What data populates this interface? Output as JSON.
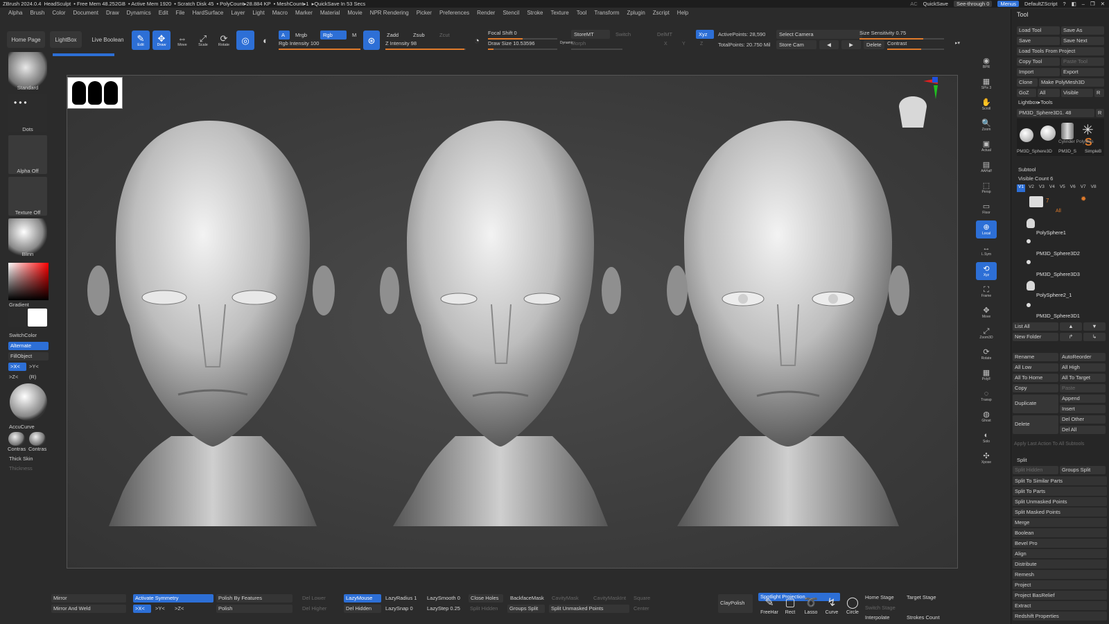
{
  "titlebar": {
    "app": "ZBrush 2024.0.4",
    "doc": "HeadSculpt",
    "free_mem": "• Free Mem 48.252GB",
    "active_mem": "• Active Mem 1920",
    "scratch": "• Scratch Disk 45",
    "polycount": "• PolyCount▸28.884 KP",
    "meshcount": "• MeshCount▸1",
    "quicksave": "▸QuickSave In 53 Secs",
    "ac": "AC",
    "quicksave_btn": "QuickSave",
    "seethrough": "See-through  0",
    "menus": "Menus",
    "defaultzscript": "DefaultZScript"
  },
  "menu": [
    "Alpha",
    "Brush",
    "Color",
    "Document",
    "Draw",
    "Dynamics",
    "Edit",
    "File",
    "HardSurface",
    "Layer",
    "Light",
    "Macro",
    "Marker",
    "Material",
    "Movie",
    "NPR Rendering",
    "Picker",
    "Preferences",
    "Render",
    "Stencil",
    "Stroke",
    "Texture",
    "Tool",
    "Transform",
    "Zplugin",
    "Zscript",
    "Help"
  ],
  "top": {
    "home_page": "Home Page",
    "lightbox": "LightBox",
    "live_boolean": "Live Boolean",
    "edit": "Edit",
    "draw": "Draw",
    "move": "Move",
    "scale": "Scale",
    "rotate": "Rotate",
    "a": "A",
    "mrgb": "Mrgb",
    "rgb": "Rgb",
    "m": "M",
    "rgb_intensity": "Rgb Intensity 100",
    "zadd": "Zadd",
    "zsub": "Zsub",
    "zcut": "Zcut",
    "z_intensity": "Z Intensity 98",
    "focal_shift": "Focal Shift 0",
    "draw_size": "Draw Size 10.53596",
    "dynamic": "Dynamic",
    "storemt": "StoreMT",
    "switch": "Switch",
    "delmt": "DelMT",
    "morph": "Morph",
    "xyz": "Xyz",
    "x": "X",
    "y": "Y",
    "z": "Z",
    "active_points": "ActivePoints: 28,590",
    "total_points": "TotalPoints: 20.750 Mil",
    "select_camera": "Select Camera",
    "store_cam": "Store Cam",
    "delete": "Delete",
    "size_sensitivity": "Size Sensitivity 0.75",
    "contrast": "Contrast"
  },
  "left": {
    "standard": "Standard",
    "dots": "Dots",
    "alpha_off": "Alpha Off",
    "texture_off": "Texture Off",
    "blinn": "Blinn",
    "gradient": "Gradient",
    "switchcolor": "SwitchColor",
    "alternate": "Alternate",
    "fillobject": "FillObject",
    "sym_x": ">X<",
    "sym_y": ">Y<",
    "sym_z": ">Z<",
    "sym_r": "(R)",
    "accucurve": "AccuCurve",
    "contrast_1": "Contras",
    "contrast_2": "Contras",
    "thick_skin": "Thick Skin",
    "thickness": "Thickness"
  },
  "right_shelf": [
    {
      "name": "bpr",
      "label": "BPR"
    },
    {
      "name": "spix",
      "label": "SPix 3"
    },
    {
      "name": "scroll",
      "label": "Scroll"
    },
    {
      "name": "zoom",
      "label": "Zoom"
    },
    {
      "name": "actual",
      "label": "Actual"
    },
    {
      "name": "aahalf",
      "label": "AAHalf"
    },
    {
      "name": "persp",
      "label": "Persp"
    },
    {
      "name": "floor",
      "label": "Floor"
    },
    {
      "name": "local",
      "label": "Local"
    },
    {
      "name": "lsym",
      "label": "L.Sym"
    },
    {
      "name": "xyz",
      "label": "Xyz"
    },
    {
      "name": "frame",
      "label": "Frame"
    },
    {
      "name": "move",
      "label": "Move"
    },
    {
      "name": "zoom3d",
      "label": "Zoom3D"
    },
    {
      "name": "rotate",
      "label": "Rotate"
    },
    {
      "name": "polyf",
      "label": "PolyF"
    },
    {
      "name": "transp",
      "label": "Transp"
    },
    {
      "name": "ghost",
      "label": "Ghost"
    },
    {
      "name": "solo",
      "label": "Solo"
    },
    {
      "name": "xpose",
      "label": "Xpose"
    }
  ],
  "tool": {
    "title": "Tool",
    "load_tool": "Load Tool",
    "save_as": "Save As",
    "save": "Save",
    "save_next": "Save Next",
    "load_from_project": "Load Tools From Project",
    "copy_tool": "Copy Tool",
    "paste_tool": "Paste Tool",
    "import": "Import",
    "export": "Export",
    "clone": "Clone",
    "make_polymesh": "Make PolyMesh3D",
    "goz": "GoZ",
    "all": "All",
    "visible": "Visible",
    "r": "R",
    "lightbox_tools": "Lightbox▸Tools",
    "current_tool": "PM3D_Sphere3D1. 48",
    "thumb_labels": [
      "PM3D_Sphere3D",
      "PM3D_S",
      "SimpleB",
      "Cylinder PolyMes"
    ],
    "subtool_head": "Subtool",
    "visible_count": "Visible Count 6",
    "versions": [
      "V1",
      "V2",
      "V3",
      "V4",
      "V5",
      "V6",
      "V7",
      "V8"
    ],
    "subtools": [
      "PolySphere1",
      "PM3D_Sphere3D2",
      "PM3D_Sphere3D3",
      "PolySphere2_1",
      "PM3D_Sphere3D1"
    ],
    "all_label": "All",
    "seven": "7",
    "list_all": "List All",
    "new_folder": "New Folder",
    "rename": "Rename",
    "autoreorder": "AutoReorder",
    "all_low": "All Low",
    "all_high": "All High",
    "all_to_home": "All To Home",
    "all_to_target": "All To Target",
    "copy": "Copy",
    "paste": "Paste",
    "duplicate": "Duplicate",
    "append": "Append",
    "insert": "Insert",
    "delete": "Delete",
    "del_other": "Del Other",
    "del_all": "Del All",
    "apply_last": "Apply Last Action To All Subtools",
    "split": "Split",
    "split_hidden": "Split Hidden",
    "groups_split": "Groups Split",
    "split_similar": "Split To Similar Parts",
    "split_parts": "Split To Parts",
    "split_unmasked": "Split Unmasked Points",
    "split_masked": "Split Masked Points",
    "merge": "Merge",
    "boolean": "Boolean",
    "bevel_pro": "Bevel Pro",
    "align": "Align",
    "distribute": "Distribute",
    "remesh": "Remesh",
    "project": "Project",
    "project_basrelief": "Project BasRelief",
    "extract": "Extract",
    "redshift": "Redshift Properties"
  },
  "bottom": {
    "mirror": "Mirror",
    "mirror_weld": "Mirror And Weld",
    "activate_symmetry": "Activate Symmetry",
    "sx": ">X<",
    "sy": ">Y<",
    "sz": ">Z<",
    "polish_features": "Polish By Features",
    "polish": "Polish",
    "del_lower": "Del Lower",
    "del_higher": "Del Higher",
    "lazymouse": "LazyMouse",
    "del_hidden": "Del Hidden",
    "lazyradius": "LazyRadius 1",
    "lazysnap": "LazySnap 0",
    "lazysmooth": "LazySmooth 0",
    "lazystep": "LazyStep 0.25",
    "close_holes": "Close Holes",
    "split_hidden": "Split Hidden",
    "backfacemask": "BackfaceMask",
    "groups_split": "Groups Split",
    "cavitymask": "CavityMask",
    "split_unmasked": "Split Unmasked Points",
    "cavitymaskint": "CavityMaskInt",
    "square": "Square",
    "center": "Center",
    "claypolish": "ClayPolish",
    "spotlight": "Spotlight Projection",
    "freehand": "FreeHar",
    "rect": "Rect",
    "lasso": "Lasso",
    "curve": "Curve",
    "circle": "Circle",
    "home_stage": "Home Stage",
    "target_stage": "Target Stage",
    "switch_stage": "Switch Stage",
    "interpolate": "Interpolate",
    "strokes_count": "Strokes Count"
  }
}
